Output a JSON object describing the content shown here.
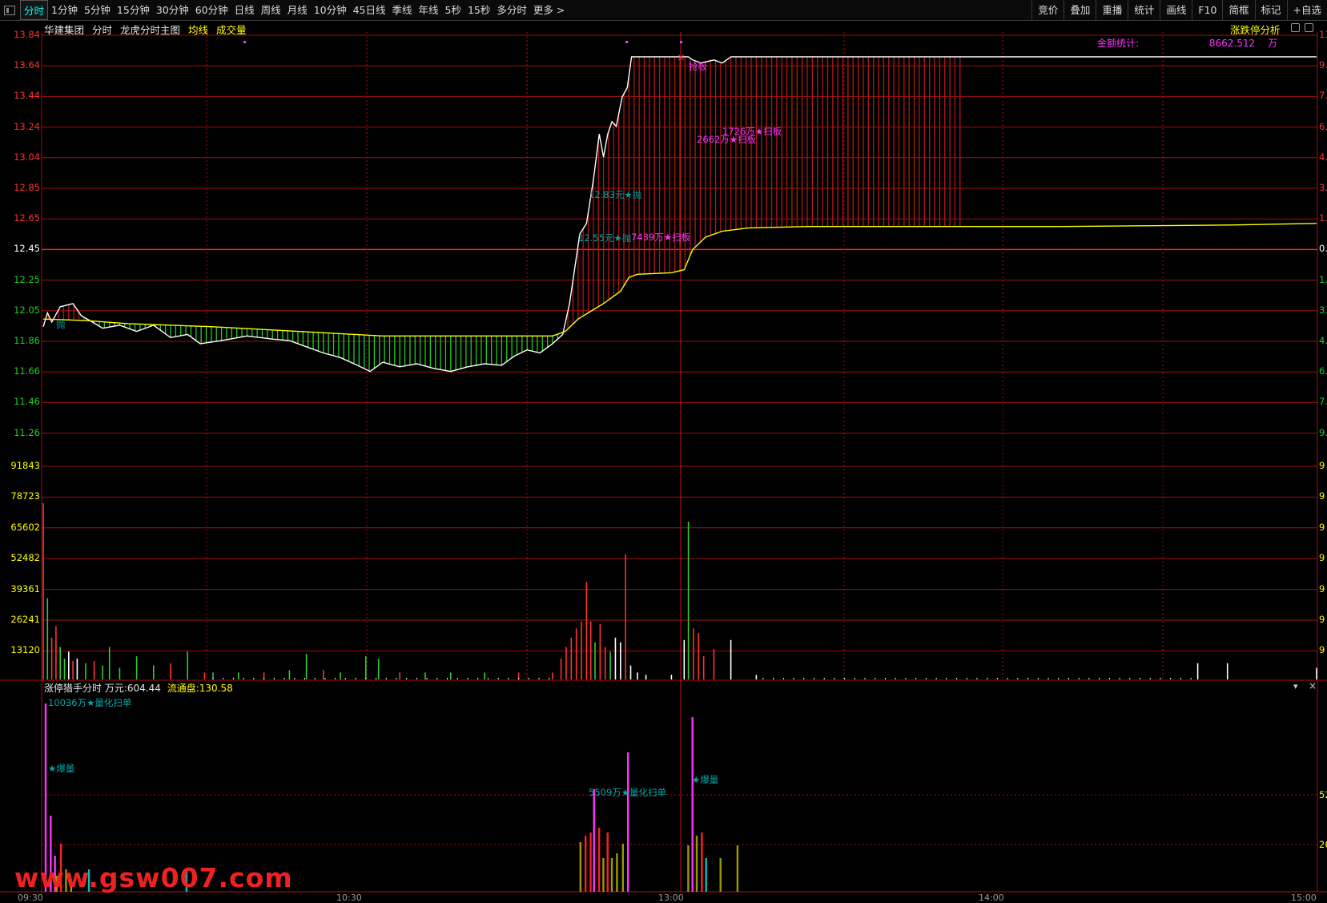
{
  "toolbar": {
    "tabs": [
      "分时",
      "1分钟",
      "5分钟",
      "15分钟",
      "30分钟",
      "60分钟",
      "日线",
      "周线",
      "月线",
      "10分钟",
      "45日线",
      "季线",
      "年线",
      "5秒",
      "15秒",
      "多分时",
      "更多 >"
    ],
    "active": "分时",
    "right": [
      "竞价",
      "叠加",
      "重播",
      "统计",
      "画线",
      "F10",
      "简框",
      "标记",
      "+自选"
    ]
  },
  "header": {
    "name": "华建集团",
    "mode": "分时",
    "chart": "龙虎分时主图",
    "avg": "均线",
    "vol": "成交量",
    "right_link": "涨跌停分析"
  },
  "amount": {
    "label": "金额统计:",
    "value": "8662.512",
    "unit": "万"
  },
  "price_axis": [
    "13.84",
    "13.64",
    "13.44",
    "13.24",
    "13.04",
    "12.85",
    "12.65",
    "12.45",
    "12.25",
    "12.05",
    "11.86",
    "11.66",
    "11.46",
    "11.26"
  ],
  "volume_axis": [
    "91843",
    "78723",
    "65602",
    "52482",
    "39361",
    "26241",
    "13120"
  ],
  "right_axis_partial": [
    "11",
    "9.",
    "7.",
    "6.",
    "4.",
    "3.",
    "1.",
    "0.",
    "1.",
    "3.",
    "4.",
    "6.",
    "7.",
    "9."
  ],
  "annotations": [
    {
      "text": "抢板",
      "color": "#ff33ff"
    },
    {
      "text": "1726万★扫板",
      "color": "#ff33ff"
    },
    {
      "text": "2662万★扫板",
      "color": "#ff33ff"
    },
    {
      "text": "12.83元★抛",
      "color": "#00a0a0"
    },
    {
      "text": "12.55元★抛",
      "color": "#00a0a0"
    },
    {
      "text": "7439万★扫板",
      "color": "#ff33ff"
    },
    {
      "text": "抛",
      "color": "#00a0a0"
    }
  ],
  "subchart": {
    "title": "涨停猎手分时",
    "unit_label": "万元:",
    "unit_value": "604.44",
    "float_label": "流通盘:",
    "float_value": "130.58",
    "annotations": [
      "10036万★量化扫单",
      "★爆量",
      "5509万★量化扫单",
      "★爆量"
    ],
    "right_axis": [
      "52",
      "26"
    ]
  },
  "time_axis": [
    "09:30",
    "10:30",
    "13:00",
    "14:00",
    "15:00"
  ],
  "watermark": "www.gsw007.com",
  "chart_data": {
    "type": "line",
    "title": "",
    "y_range": [
      11.26,
      13.84
    ],
    "series": [
      {
        "name": "",
        "color": "#ffffff",
        "points": [
          [
            0,
            11.95
          ],
          [
            5,
            12.04
          ],
          [
            10,
            11.98
          ],
          [
            20,
            12.08
          ],
          [
            35,
            12.1
          ],
          [
            45,
            12.02
          ],
          [
            55,
            11.99
          ],
          [
            70,
            11.94
          ],
          [
            90,
            11.96
          ],
          [
            110,
            11.92
          ],
          [
            130,
            11.96
          ],
          [
            150,
            11.88
          ],
          [
            170,
            11.9
          ],
          [
            185,
            11.84
          ],
          [
            210,
            11.86
          ],
          [
            240,
            11.89
          ],
          [
            270,
            11.87
          ],
          [
            290,
            11.86
          ],
          [
            310,
            11.82
          ],
          [
            330,
            11.78
          ],
          [
            350,
            11.75
          ],
          [
            370,
            11.7
          ],
          [
            385,
            11.66
          ],
          [
            400,
            11.72
          ],
          [
            420,
            11.69
          ],
          [
            440,
            11.71
          ],
          [
            460,
            11.68
          ],
          [
            480,
            11.66
          ],
          [
            500,
            11.69
          ],
          [
            520,
            11.71
          ],
          [
            540,
            11.7
          ],
          [
            555,
            11.76
          ],
          [
            570,
            11.8
          ],
          [
            585,
            11.78
          ],
          [
            600,
            11.84
          ],
          [
            612,
            11.9
          ],
          [
            620,
            12.1
          ],
          [
            632,
            12.55
          ],
          [
            640,
            12.62
          ],
          [
            648,
            12.9
          ],
          [
            655,
            13.2
          ],
          [
            660,
            13.05
          ],
          [
            665,
            13.2
          ],
          [
            670,
            13.28
          ],
          [
            675,
            13.25
          ],
          [
            682,
            13.44
          ],
          [
            688,
            13.5
          ],
          [
            693,
            13.7
          ],
          [
            760,
            13.7
          ],
          [
            765,
            13.68
          ],
          [
            775,
            13.66
          ],
          [
            790,
            13.68
          ],
          [
            800,
            13.66
          ],
          [
            810,
            13.7
          ],
          [
            1500,
            13.7
          ]
        ]
      },
      {
        "name": "",
        "color": "#ffff00",
        "points": [
          [
            0,
            12.0
          ],
          [
            50,
            11.99
          ],
          [
            100,
            11.97
          ],
          [
            200,
            11.95
          ],
          [
            300,
            11.92
          ],
          [
            400,
            11.89
          ],
          [
            500,
            11.89
          ],
          [
            600,
            11.89
          ],
          [
            615,
            11.92
          ],
          [
            630,
            12.0
          ],
          [
            645,
            12.05
          ],
          [
            660,
            12.1
          ],
          [
            680,
            12.18
          ],
          [
            690,
            12.27
          ],
          [
            700,
            12.29
          ],
          [
            740,
            12.3
          ],
          [
            755,
            12.32
          ],
          [
            765,
            12.45
          ],
          [
            780,
            12.53
          ],
          [
            800,
            12.57
          ],
          [
            830,
            12.59
          ],
          [
            900,
            12.6
          ],
          [
            1000,
            12.6
          ],
          [
            1200,
            12.6
          ],
          [
            1400,
            12.61
          ],
          [
            1500,
            12.62
          ]
        ]
      }
    ],
    "volumes": [
      {
        "x": 0,
        "v": 76000,
        "c": "#ff3333"
      },
      {
        "x": 5,
        "v": 35000,
        "c": "#33cc33"
      },
      {
        "x": 10,
        "v": 18000,
        "c": "#ff3333"
      },
      {
        "x": 15,
        "v": 23000,
        "c": "#ff3333"
      },
      {
        "x": 20,
        "v": 14000,
        "c": "#33cc33"
      },
      {
        "x": 25,
        "v": 9000,
        "c": "#33cc33"
      },
      {
        "x": 30,
        "v": 12000,
        "c": "#ffffff"
      },
      {
        "x": 35,
        "v": 8000,
        "c": "#ff3333"
      },
      {
        "x": 40,
        "v": 9000,
        "c": "#ffffff"
      },
      {
        "x": 50,
        "v": 7000,
        "c": "#33cc33"
      },
      {
        "x": 60,
        "v": 8000,
        "c": "#ff3333"
      },
      {
        "x": 70,
        "v": 6000,
        "c": "#33cc33"
      },
      {
        "x": 78,
        "v": 14000,
        "c": "#33cc33"
      },
      {
        "x": 90,
        "v": 5000,
        "c": "#33cc33"
      },
      {
        "x": 110,
        "v": 10000,
        "c": "#33cc33"
      },
      {
        "x": 130,
        "v": 6000,
        "c": "#33cc33"
      },
      {
        "x": 150,
        "v": 7000,
        "c": "#ff3333"
      },
      {
        "x": 170,
        "v": 12000,
        "c": "#33cc33"
      },
      {
        "x": 190,
        "v": 3000,
        "c": "#ff3333"
      },
      {
        "x": 200,
        "v": 3000,
        "c": "#33cc33"
      },
      {
        "x": 230,
        "v": 3000,
        "c": "#33cc33"
      },
      {
        "x": 260,
        "v": 3000,
        "c": "#ff3333"
      },
      {
        "x": 290,
        "v": 4000,
        "c": "#33cc33"
      },
      {
        "x": 310,
        "v": 11000,
        "c": "#33cc33"
      },
      {
        "x": 330,
        "v": 4000,
        "c": "#ff3333"
      },
      {
        "x": 350,
        "v": 3000,
        "c": "#33cc33"
      },
      {
        "x": 380,
        "v": 10000,
        "c": "#33cc33"
      },
      {
        "x": 395,
        "v": 9000,
        "c": "#33cc33"
      },
      {
        "x": 420,
        "v": 3000,
        "c": "#ff3333"
      },
      {
        "x": 450,
        "v": 3000,
        "c": "#33cc33"
      },
      {
        "x": 480,
        "v": 3000,
        "c": "#33cc33"
      },
      {
        "x": 520,
        "v": 3000,
        "c": "#33cc33"
      },
      {
        "x": 560,
        "v": 3000,
        "c": "#ff3333"
      },
      {
        "x": 600,
        "v": 3000,
        "c": "#ff3333"
      },
      {
        "x": 610,
        "v": 9000,
        "c": "#ff3333"
      },
      {
        "x": 616,
        "v": 14000,
        "c": "#ff3333"
      },
      {
        "x": 622,
        "v": 18000,
        "c": "#ff3333"
      },
      {
        "x": 628,
        "v": 22000,
        "c": "#ff3333"
      },
      {
        "x": 634,
        "v": 25000,
        "c": "#ff3333"
      },
      {
        "x": 640,
        "v": 42000,
        "c": "#ff3333"
      },
      {
        "x": 645,
        "v": 25000,
        "c": "#ff3333"
      },
      {
        "x": 650,
        "v": 16000,
        "c": "#33cc33"
      },
      {
        "x": 656,
        "v": 24000,
        "c": "#ff3333"
      },
      {
        "x": 662,
        "v": 14000,
        "c": "#ff3333"
      },
      {
        "x": 668,
        "v": 12000,
        "c": "#33cc33"
      },
      {
        "x": 674,
        "v": 18000,
        "c": "#ffffff"
      },
      {
        "x": 680,
        "v": 16000,
        "c": "#ffffff"
      },
      {
        "x": 686,
        "v": 54000,
        "c": "#ff3333"
      },
      {
        "x": 692,
        "v": 6000,
        "c": "#ffffff"
      },
      {
        "x": 700,
        "v": 3000,
        "c": "#ffffff"
      },
      {
        "x": 710,
        "v": 2000,
        "c": "#ffffff"
      },
      {
        "x": 740,
        "v": 2000,
        "c": "#ffffff"
      },
      {
        "x": 755,
        "v": 17000,
        "c": "#ffffff"
      },
      {
        "x": 760,
        "v": 68000,
        "c": "#33cc33"
      },
      {
        "x": 766,
        "v": 22000,
        "c": "#ff3333"
      },
      {
        "x": 772,
        "v": 20000,
        "c": "#ff3333"
      },
      {
        "x": 778,
        "v": 10000,
        "c": "#ff3333"
      },
      {
        "x": 790,
        "v": 13000,
        "c": "#ff3333"
      },
      {
        "x": 810,
        "v": 17000,
        "c": "#ffffff"
      },
      {
        "x": 840,
        "v": 2000,
        "c": "#ffffff"
      },
      {
        "x": 1360,
        "v": 7000,
        "c": "#ffffff"
      },
      {
        "x": 1395,
        "v": 7000,
        "c": "#ffffff"
      },
      {
        "x": 1500,
        "v": 5000,
        "c": "#ffffff"
      }
    ]
  }
}
